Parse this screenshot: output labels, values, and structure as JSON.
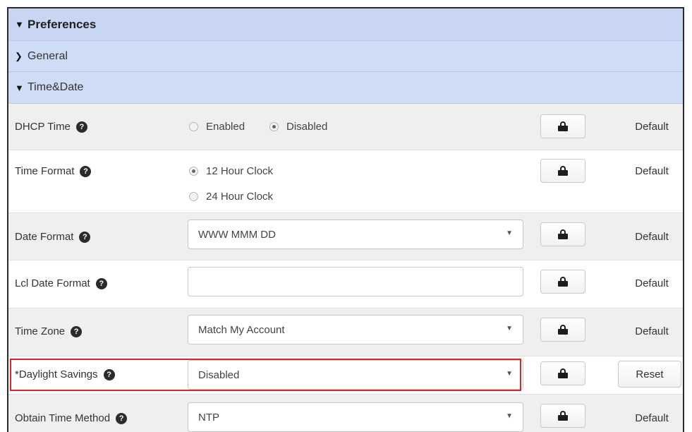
{
  "sections": {
    "preferences": "Preferences",
    "general": "General",
    "time_date": "Time&Date"
  },
  "help_glyph": "?",
  "icons": {
    "expanded": "chevron-down-icon",
    "collapsed": "chevron-right-icon",
    "lock": "lock-icon",
    "help": "help-icon"
  },
  "rows": {
    "dhcp_time": {
      "label": "DHCP Time",
      "options": [
        "Enabled",
        "Disabled"
      ],
      "selected": "Disabled",
      "action": "Default"
    },
    "time_format": {
      "label": "Time Format",
      "options": [
        "12 Hour Clock",
        "24 Hour Clock"
      ],
      "selected": "12 Hour Clock",
      "action": "Default"
    },
    "date_format": {
      "label": "Date Format",
      "value": "WWW MMM DD",
      "action": "Default"
    },
    "lcl_date_format": {
      "label": "Lcl Date Format",
      "value": "",
      "action": "Default"
    },
    "time_zone": {
      "label": "Time Zone",
      "value": "Match My Account",
      "action": "Default"
    },
    "daylight_savings": {
      "label": "*Daylight Savings",
      "value": "Disabled",
      "action": "Reset"
    },
    "obtain_time_method": {
      "label": "Obtain Time Method",
      "value": "NTP",
      "action": "Default"
    }
  },
  "colors": {
    "header_bg": "#c9d6f3",
    "highlight": "#d62828",
    "row_alt": "#efefef"
  }
}
